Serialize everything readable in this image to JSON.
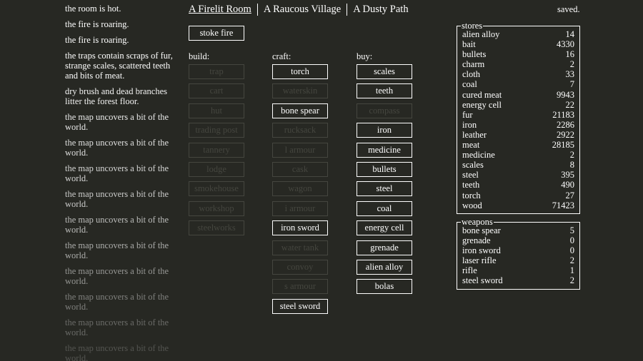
{
  "notifications": [
    {
      "text": "the room is hot.",
      "opacity": 1
    },
    {
      "text": "the fire is roaring.",
      "opacity": 1
    },
    {
      "text": "the fire is roaring.",
      "opacity": 1
    },
    {
      "text": "the traps contain scraps of fur, strange scales, scattered teeth and bits of meat.",
      "opacity": 1
    },
    {
      "text": "dry brush and dead branches litter the forest floor.",
      "opacity": 0.95
    },
    {
      "text": "the map uncovers a bit of the world.",
      "opacity": 0.9
    },
    {
      "text": "the map uncovers a bit of the world.",
      "opacity": 0.85
    },
    {
      "text": "the map uncovers a bit of the world.",
      "opacity": 0.8
    },
    {
      "text": "the map uncovers a bit of the world.",
      "opacity": 0.75
    },
    {
      "text": "the map uncovers a bit of the world.",
      "opacity": 0.68
    },
    {
      "text": "the map uncovers a bit of the world.",
      "opacity": 0.6
    },
    {
      "text": "the map uncovers a bit of the world.",
      "opacity": 0.5
    },
    {
      "text": "the map uncovers a bit of the world.",
      "opacity": 0.4
    },
    {
      "text": "the map uncovers a bit of the world.",
      "opacity": 0.3
    },
    {
      "text": "the map uncovers a bit of the world.",
      "opacity": 0.2
    }
  ],
  "header": {
    "locations": [
      {
        "label": "A Firelit Room",
        "selected": true
      },
      {
        "label": "A Raucous Village",
        "selected": false
      },
      {
        "label": "A Dusty Path",
        "selected": false
      }
    ],
    "saved": "saved."
  },
  "stoke_fire": "stoke fire",
  "build": {
    "label": "build:",
    "items": [
      {
        "label": "trap",
        "enabled": false
      },
      {
        "label": "cart",
        "enabled": false
      },
      {
        "label": "hut",
        "enabled": false
      },
      {
        "label": "trading post",
        "enabled": false
      },
      {
        "label": "tannery",
        "enabled": false
      },
      {
        "label": "lodge",
        "enabled": false
      },
      {
        "label": "smokehouse",
        "enabled": false
      },
      {
        "label": "workshop",
        "enabled": false
      },
      {
        "label": "steelworks",
        "enabled": false
      }
    ]
  },
  "craft": {
    "label": "craft:",
    "items": [
      {
        "label": "torch",
        "enabled": true
      },
      {
        "label": "waterskin",
        "enabled": false
      },
      {
        "label": "bone spear",
        "enabled": true
      },
      {
        "label": "rucksack",
        "enabled": false
      },
      {
        "label": "l armour",
        "enabled": false
      },
      {
        "label": "cask",
        "enabled": false
      },
      {
        "label": "wagon",
        "enabled": false
      },
      {
        "label": "i armour",
        "enabled": false
      },
      {
        "label": "iron sword",
        "enabled": true
      },
      {
        "label": "water tank",
        "enabled": false
      },
      {
        "label": "convoy",
        "enabled": false
      },
      {
        "label": "s armour",
        "enabled": false
      },
      {
        "label": "steel sword",
        "enabled": true
      }
    ]
  },
  "buy": {
    "label": "buy:",
    "items": [
      {
        "label": "scales",
        "enabled": true
      },
      {
        "label": "teeth",
        "enabled": true
      },
      {
        "label": "compass",
        "enabled": false
      },
      {
        "label": "iron",
        "enabled": true
      },
      {
        "label": "medicine",
        "enabled": true
      },
      {
        "label": "bullets",
        "enabled": true
      },
      {
        "label": "steel",
        "enabled": true
      },
      {
        "label": "coal",
        "enabled": true
      },
      {
        "label": "energy cell",
        "enabled": true
      },
      {
        "label": "grenade",
        "enabled": true
      },
      {
        "label": "alien alloy",
        "enabled": true
      },
      {
        "label": "bolas",
        "enabled": true
      }
    ]
  },
  "stores": {
    "title": "stores",
    "items": [
      {
        "name": "alien alloy",
        "value": "14"
      },
      {
        "name": "bait",
        "value": "4330"
      },
      {
        "name": "bullets",
        "value": "16"
      },
      {
        "name": "charm",
        "value": "2"
      },
      {
        "name": "cloth",
        "value": "33"
      },
      {
        "name": "coal",
        "value": "7"
      },
      {
        "name": "cured meat",
        "value": "9943"
      },
      {
        "name": "energy cell",
        "value": "22"
      },
      {
        "name": "fur",
        "value": "21183"
      },
      {
        "name": "iron",
        "value": "2286"
      },
      {
        "name": "leather",
        "value": "2922"
      },
      {
        "name": "meat",
        "value": "28185"
      },
      {
        "name": "medicine",
        "value": "2"
      },
      {
        "name": "scales",
        "value": "8"
      },
      {
        "name": "steel",
        "value": "395"
      },
      {
        "name": "teeth",
        "value": "490"
      },
      {
        "name": "torch",
        "value": "27"
      },
      {
        "name": "wood",
        "value": "71423"
      }
    ]
  },
  "weapons": {
    "title": "weapons",
    "items": [
      {
        "name": "bone spear",
        "value": "5"
      },
      {
        "name": "grenade",
        "value": "0"
      },
      {
        "name": "iron sword",
        "value": "0"
      },
      {
        "name": "laser rifle",
        "value": "2"
      },
      {
        "name": "rifle",
        "value": "1"
      },
      {
        "name": "steel sword",
        "value": "2"
      }
    ]
  }
}
